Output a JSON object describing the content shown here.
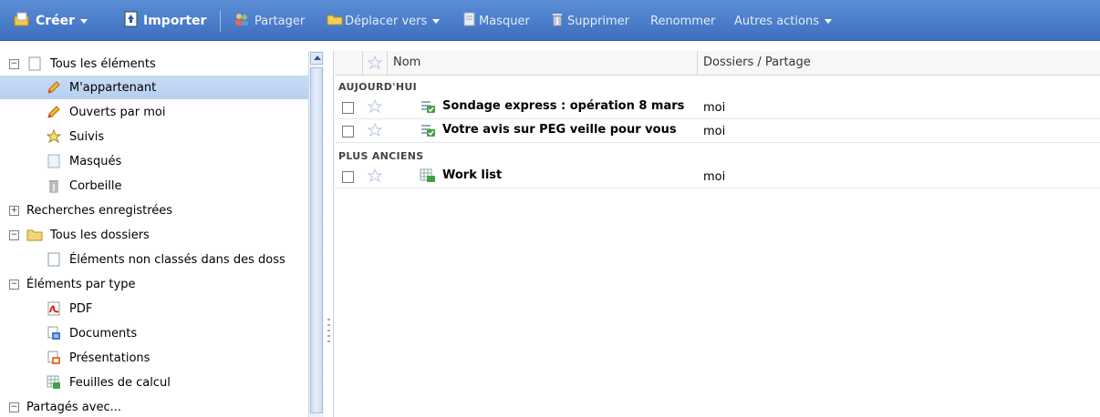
{
  "toolbar": {
    "create": "Créer",
    "import": "Importer",
    "share": "Partager",
    "move": "Déplacer vers",
    "hide": "Masquer",
    "delete": "Supprimer",
    "rename": "Renommer",
    "more": "Autres actions"
  },
  "sidebar": {
    "all_items": "Tous les éléments",
    "owned": "M'appartenant",
    "opened": "Ouverts par moi",
    "starred": "Suivis",
    "hidden": "Masqués",
    "trash": "Corbeille",
    "saved_searches": "Recherches enregistrées",
    "all_folders": "Tous les dossiers",
    "unfiled": "Éléments non classés dans des doss",
    "by_type": "Éléments par type",
    "pdf": "PDF",
    "documents": "Documents",
    "presentations": "Présentations",
    "spreadsheets": "Feuilles de calcul",
    "shared_with": "Partagés avec..."
  },
  "list": {
    "col_name": "Nom",
    "col_folders": "Dossiers / Partage",
    "group_today": "AUJOURD'HUI",
    "group_older": "PLUS ANCIENS",
    "rows": [
      {
        "name": "Sondage express : opération 8 mars",
        "share": "moi",
        "type": "form"
      },
      {
        "name": "Votre avis sur PEG veille pour vous",
        "share": "moi",
        "type": "form"
      },
      {
        "name": "Work list",
        "share": "moi",
        "type": "spreadsheet"
      }
    ]
  },
  "colors": {
    "toolbar": "#4a7dcb",
    "selection": "#c1d6f3",
    "star": "#b9c8e0"
  }
}
